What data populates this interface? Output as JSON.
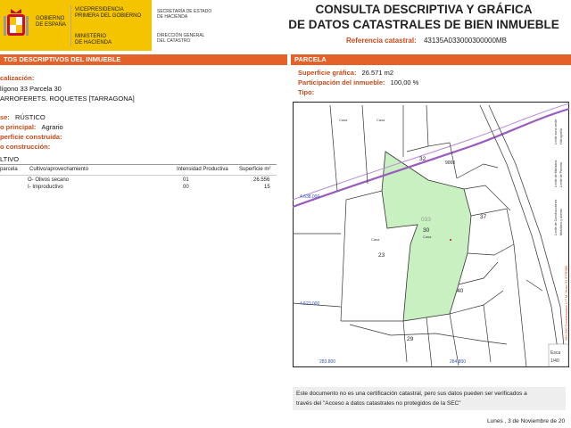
{
  "header": {
    "gov_line1": "GOBIERNO",
    "gov_line2": "DE ESPAÑA",
    "vice_line1": "VICEPRESIDENCIA",
    "vice_line2": "PRIMERA DEL GOBIERNO",
    "ministry_line1": "MINISTERIO",
    "ministry_line2": "DE HACIENDA",
    "secretaria_line1": "SECRETARÍA DE ESTADO",
    "secretaria_line2": "DE HACIENDA",
    "direccion_line1": "DIRECCIÓN GENERAL",
    "direccion_line2": "DEL CATASTRO",
    "title_line1": "CONSULTA DESCRIPTIVA Y GRÁFICA",
    "title_line2": "DE DATOS CATASTRALES DE BIEN INMUEBLE",
    "ref_label": "Referencia catastral:",
    "ref_value": "43135A033000300000MB",
    "brand_color": "#f4c400",
    "accent_color": "#e4622a"
  },
  "left": {
    "section_title": "TOS DESCRIPTIVOS DEL INMUEBLE",
    "loc_label": "calización:",
    "loc_line1": "lígono 33 Parcela 30",
    "loc_line2": "ARROFERETS. ROQUETES [TARRAGONA]",
    "clase_label": "se:",
    "clase_value": "RÚSTICO",
    "uso_label": "o principal:",
    "uso_value": "Agrario",
    "sup_label": "perficie construida:",
    "ano_label": "o construcción:",
    "cultivo_title": "LTIVO",
    "table_headers": [
      "parcela",
      "Cultivo/aprovechamiento",
      "Intensidad Productiva",
      "Superficie m²"
    ],
    "rows": [
      {
        "parcela": "",
        "cultivo": "O- Olivos secano",
        "intensidad": "01",
        "superficie": "26.556"
      },
      {
        "parcela": "",
        "cultivo": "I- Improductivo",
        "intensidad": "00",
        "superficie": "15"
      }
    ]
  },
  "right": {
    "section_title": "PARCELA",
    "sup_label": "Superficie gráfica:",
    "sup_value": "26.571 m2",
    "part_label": "Participación del inmueble:",
    "part_value": "100,00 %",
    "tipo_label": "Tipo:"
  },
  "map": {
    "parcel_labels": [
      "32",
      "9006",
      "033",
      "30",
      "37",
      "23",
      "40",
      "29"
    ],
    "casa_labels": [
      "Casa",
      "Casa",
      "Casa",
      "Casa"
    ],
    "coord_y1": "4.638.000",
    "coord_y2": "4.523.000",
    "coord_x1": "283.800",
    "coord_x2": "284.800",
    "side_text": "284.200 Coordenadas U.T.M. Huso 31 ETRS89",
    "legend_items": [
      "Limite de Manzana",
      "Limite de Parcela",
      "Limite de Construcciones",
      "Mobiliario y aceras",
      "Limite zona verde",
      "Hidrografía"
    ],
    "scale_label": "Esca",
    "scale_value": "1/40",
    "parcel_fill": "#c8f0c0"
  },
  "footer": {
    "note_line1": "Este documento no es una certificación catastral, pero sus datos pueden ser verificados a",
    "note_line2": "través del \"Acceso a datos catastrales no protegidos de la SEC\"",
    "date": "Lunes , 3 de Noviembre de 20"
  }
}
